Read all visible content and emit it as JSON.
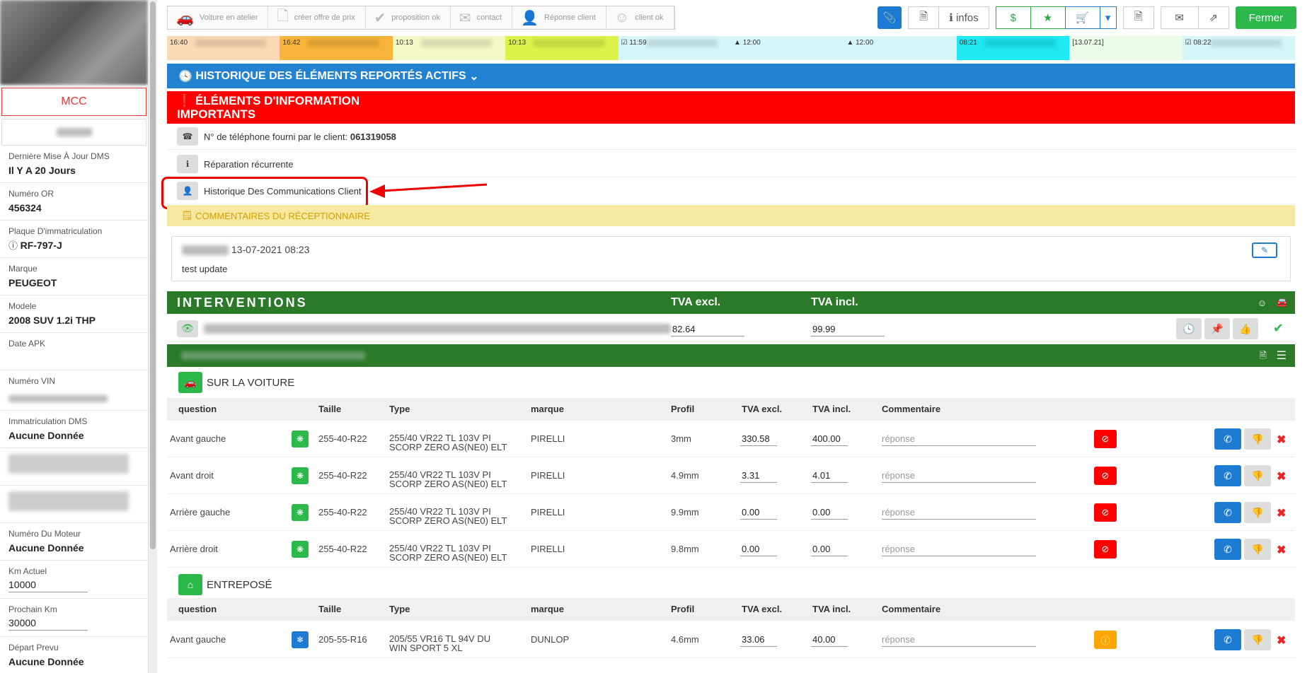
{
  "sidebar": {
    "badge": "MCC",
    "fields": [
      {
        "label": "Dernière Mise À Jour DMS",
        "value": "Il Y A 20 Jours"
      },
      {
        "label": "Numéro OR",
        "value": "456324"
      },
      {
        "label": "Plaque D'immatriculation",
        "value": "RF-797-J"
      },
      {
        "label": "Marque",
        "value": "PEUGEOT"
      },
      {
        "label": "Modele",
        "value": "2008 SUV 1.2i THP"
      },
      {
        "label": "Date APK",
        "value": ""
      },
      {
        "label": "Numéro VIN",
        "value": ""
      },
      {
        "label": "Immatriculation DMS",
        "value": "Aucune Donnée"
      },
      {
        "label": "Numéro Du Moteur",
        "value": "Aucune Donnée"
      },
      {
        "label": "Km Actuel",
        "value": "10000"
      },
      {
        "label": "Prochain Km",
        "value": "30000"
      },
      {
        "label": "Départ Prevu",
        "value": "Aucune Donnée"
      }
    ]
  },
  "toolbar": {
    "steps": [
      "Voiture en atelier",
      "créer offre de prix",
      "proposition ok",
      "contact",
      "Réponse client",
      "client ok"
    ],
    "infos_label": "infos",
    "close_label": "Fermer"
  },
  "timeline": [
    {
      "text": "16:40",
      "color": "#fbd9b5"
    },
    {
      "text": "16:42",
      "color": "#f7b33a"
    },
    {
      "text": "10:13",
      "color": "#f4f8c6"
    },
    {
      "text": "10:13",
      "color": "#dcf24a"
    },
    {
      "text": "☑ 11:59",
      "color": "#d4f6f8"
    },
    {
      "text": "▲ 12:00",
      "color": "#d4f6f8"
    },
    {
      "text": "▲ 12:00",
      "color": "#d4f6f8"
    },
    {
      "text": "08:21",
      "color": "#1ee8f2"
    },
    {
      "text": "[13.07.21]",
      "color": "#e9fbe9"
    },
    {
      "text": "☑ 08:22",
      "color": "#d4f6f8"
    }
  ],
  "history_title": "HISTORIQUE DES ÉLÉMENTS REPORTÉS ACTIFS",
  "important_title": "ÉLÉMENTS D'INFORMATION IMPORTANTS",
  "info_rows": {
    "phone_label": "N° de téléphone fourni par le client:",
    "phone_value": "061319058",
    "recurrent": "Réparation récurrente",
    "comm_history": "Historique Des Communications Client"
  },
  "comments": {
    "title": "COMMENTAIRES DU RÉCEPTIONNAIRE",
    "date": "13-07-2021 08:23",
    "text": "test update"
  },
  "interventions": {
    "title": "INTERVENTIONS",
    "col_excl": "TVA excl.",
    "col_incl": "TVA incl.",
    "row_excl": "82.64",
    "row_incl": "99.99"
  },
  "table_headers": [
    "question",
    "Taille",
    "Type",
    "marque",
    "Profil",
    "TVA excl.",
    "TVA incl.",
    "Commentaire"
  ],
  "reply_placeholder": "réponse",
  "car_section": {
    "title": "SUR LA VOITURE",
    "rows": [
      {
        "q": "Avant gauche",
        "size": "255-40-R22",
        "type": "255/40 VR22 TL 103V PI SCORP ZERO AS(NE0) ELT",
        "brand": "PIRELLI",
        "profile": "3mm",
        "excl": "330.58",
        "incl": "400.00"
      },
      {
        "q": "Avant droit",
        "size": "255-40-R22",
        "type": "255/40 VR22 TL 103V PI SCORP ZERO AS(NE0) ELT",
        "brand": "PIRELLI",
        "profile": "4.9mm",
        "excl": "3.31",
        "incl": "4.01"
      },
      {
        "q": "Arrière gauche",
        "size": "255-40-R22",
        "type": "255/40 VR22 TL 103V PI SCORP ZERO AS(NE0) ELT",
        "brand": "PIRELLI",
        "profile": "9.9mm",
        "excl": "0.00",
        "incl": "0.00"
      },
      {
        "q": "Arrière droit",
        "size": "255-40-R22",
        "type": "255/40 VR22 TL 103V PI SCORP ZERO AS(NE0) ELT",
        "brand": "PIRELLI",
        "profile": "9.8mm",
        "excl": "0.00",
        "incl": "0.00"
      }
    ]
  },
  "stored_section": {
    "title": "ENTREPOSÉ",
    "rows": [
      {
        "q": "Avant gauche",
        "size": "205-55-R16",
        "type": "205/55 VR16 TL 94V DU WIN SPORT 5 XL",
        "brand": "DUNLOP",
        "profile": "4.6mm",
        "excl": "33.06",
        "incl": "40.00"
      }
    ]
  }
}
